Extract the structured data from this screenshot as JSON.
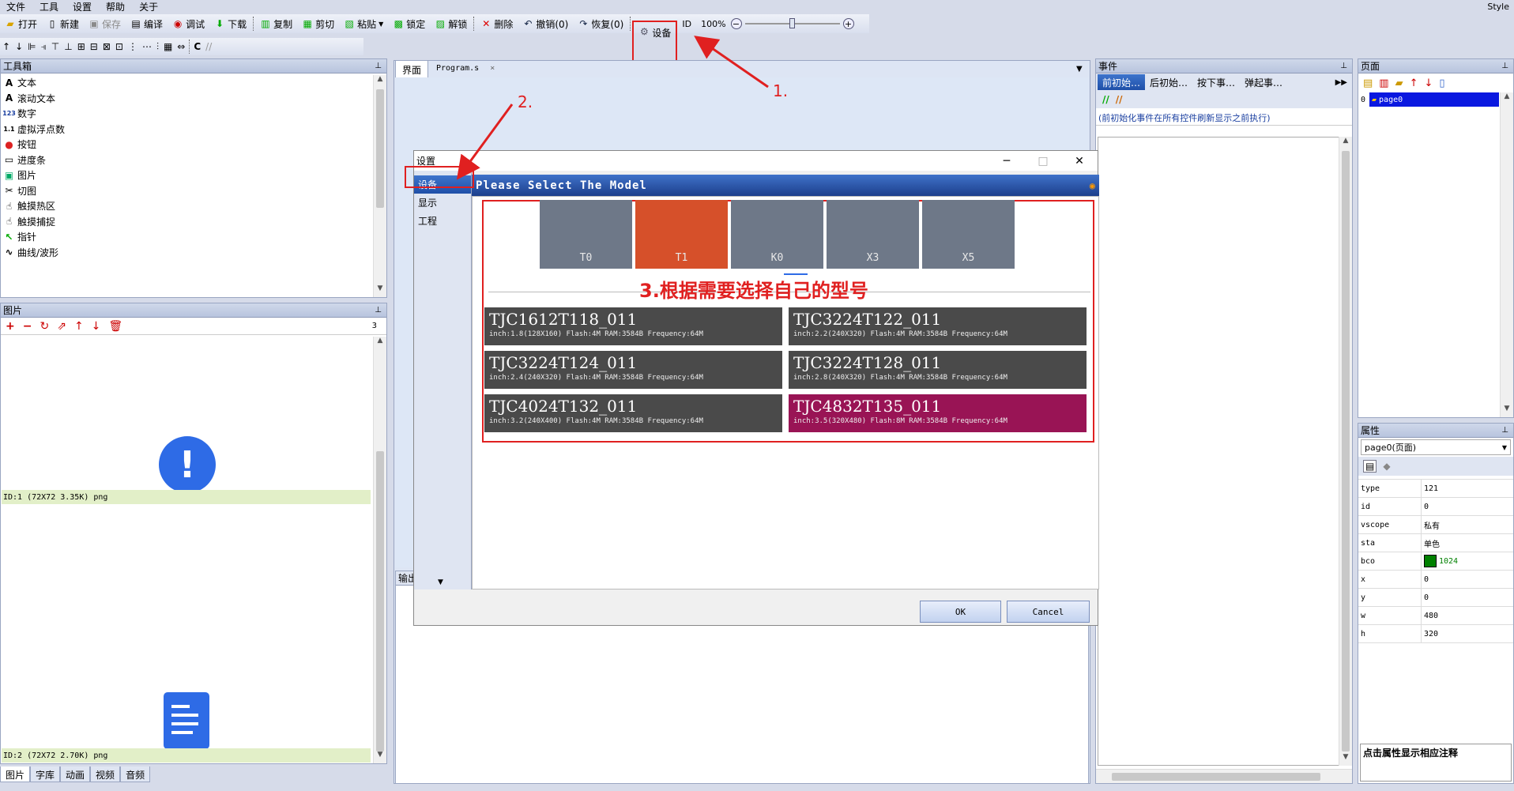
{
  "menu": {
    "items": [
      "文件",
      "工具",
      "设置",
      "帮助",
      "关于"
    ],
    "style": "Style"
  },
  "toolbar": {
    "open": "打开",
    "new": "新建",
    "save": "保存",
    "compile": "编译",
    "debug": "调试",
    "download": "下载",
    "copy": "复制",
    "cut": "剪切",
    "paste": "粘贴",
    "lock": "锁定",
    "unlock": "解锁",
    "delete": "删除",
    "undo": "撤销(0)",
    "redo": "恢复(0)",
    "settings": "设备",
    "id": "ID",
    "zoom": "100%"
  },
  "toolbox": {
    "title": "工具箱",
    "items": [
      {
        "icon": "A",
        "label": "文本"
      },
      {
        "icon": "A",
        "label": "滚动文本"
      },
      {
        "icon": "123",
        "label": "数字"
      },
      {
        "icon": "1.1",
        "label": "虚拟浮点数"
      },
      {
        "icon": "●",
        "label": "按钮"
      },
      {
        "icon": "▭",
        "label": "进度条"
      },
      {
        "icon": "▣",
        "label": "图片"
      },
      {
        "icon": "✂",
        "label": "切图"
      },
      {
        "icon": "☝",
        "label": "触摸热区"
      },
      {
        "icon": "☝",
        "label": "触摸捕捉"
      },
      {
        "icon": "↖",
        "label": "指针"
      },
      {
        "icon": "∿",
        "label": "曲线/波形"
      }
    ]
  },
  "pictures": {
    "title": "图片",
    "count": "3",
    "items": [
      {
        "label": "ID:1  (72X72 3.35K) png"
      },
      {
        "label": "ID:2  (72X72 2.70K) png"
      }
    ]
  },
  "bottom_tabs": [
    "图片",
    "字库",
    "动画",
    "视频",
    "音频"
  ],
  "doc_tabs": [
    "界面",
    "Program.s"
  ],
  "output_title": "输出",
  "events": {
    "title": "事件",
    "tabs": [
      "前初始…",
      "后初始…",
      "按下事…",
      "弹起事…"
    ],
    "hint": "(前初始化事件在所有控件刷新显示之前执行)"
  },
  "pages": {
    "title": "页面",
    "items": [
      {
        "index": "0",
        "name": "page0"
      }
    ]
  },
  "properties": {
    "title": "属性",
    "selected": "page0(页面)",
    "rows": [
      {
        "k": "type",
        "v": "121"
      },
      {
        "k": "id",
        "v": "0"
      },
      {
        "k": "vscope",
        "v": "私有"
      },
      {
        "k": "sta",
        "v": "单色"
      },
      {
        "k": "bco",
        "v": "1024"
      },
      {
        "k": "x",
        "v": "0"
      },
      {
        "k": "y",
        "v": "0"
      },
      {
        "k": "w",
        "v": "480"
      },
      {
        "k": "h",
        "v": "320"
      }
    ],
    "hint": "点击属性显示相应注释",
    "bco_color": "#008000"
  },
  "dialog": {
    "title": "设置",
    "side": [
      "设备",
      "显示",
      "工程"
    ],
    "header": "Please Select The Model",
    "series": [
      "T0",
      "T1",
      "K0",
      "X3",
      "X5"
    ],
    "active_series": 1,
    "models": [
      {
        "name": "TJC1612T118_011",
        "spec": "inch:1.8(128X160) Flash:4M RAM:3584B Frequency:64M"
      },
      {
        "name": "TJC3224T122_011",
        "spec": "inch:2.2(240X320) Flash:4M RAM:3584B Frequency:64M"
      },
      {
        "name": "TJC3224T124_011",
        "spec": "inch:2.4(240X320) Flash:4M RAM:3584B Frequency:64M"
      },
      {
        "name": "TJC3224T128_011",
        "spec": "inch:2.8(240X320) Flash:4M RAM:3584B Frequency:64M"
      },
      {
        "name": "TJC4024T132_011",
        "spec": "inch:3.2(240X400) Flash:4M RAM:3584B Frequency:64M"
      },
      {
        "name": "TJC4832T135_011",
        "spec": "inch:3.5(320X480) Flash:8M RAM:3584B Frequency:64M"
      }
    ],
    "ok": "OK",
    "cancel": "Cancel"
  },
  "annotations": {
    "step1": "1.",
    "step2": "2.",
    "step3": "3.根据需要选择自己的型号",
    "color": "#e02020"
  }
}
